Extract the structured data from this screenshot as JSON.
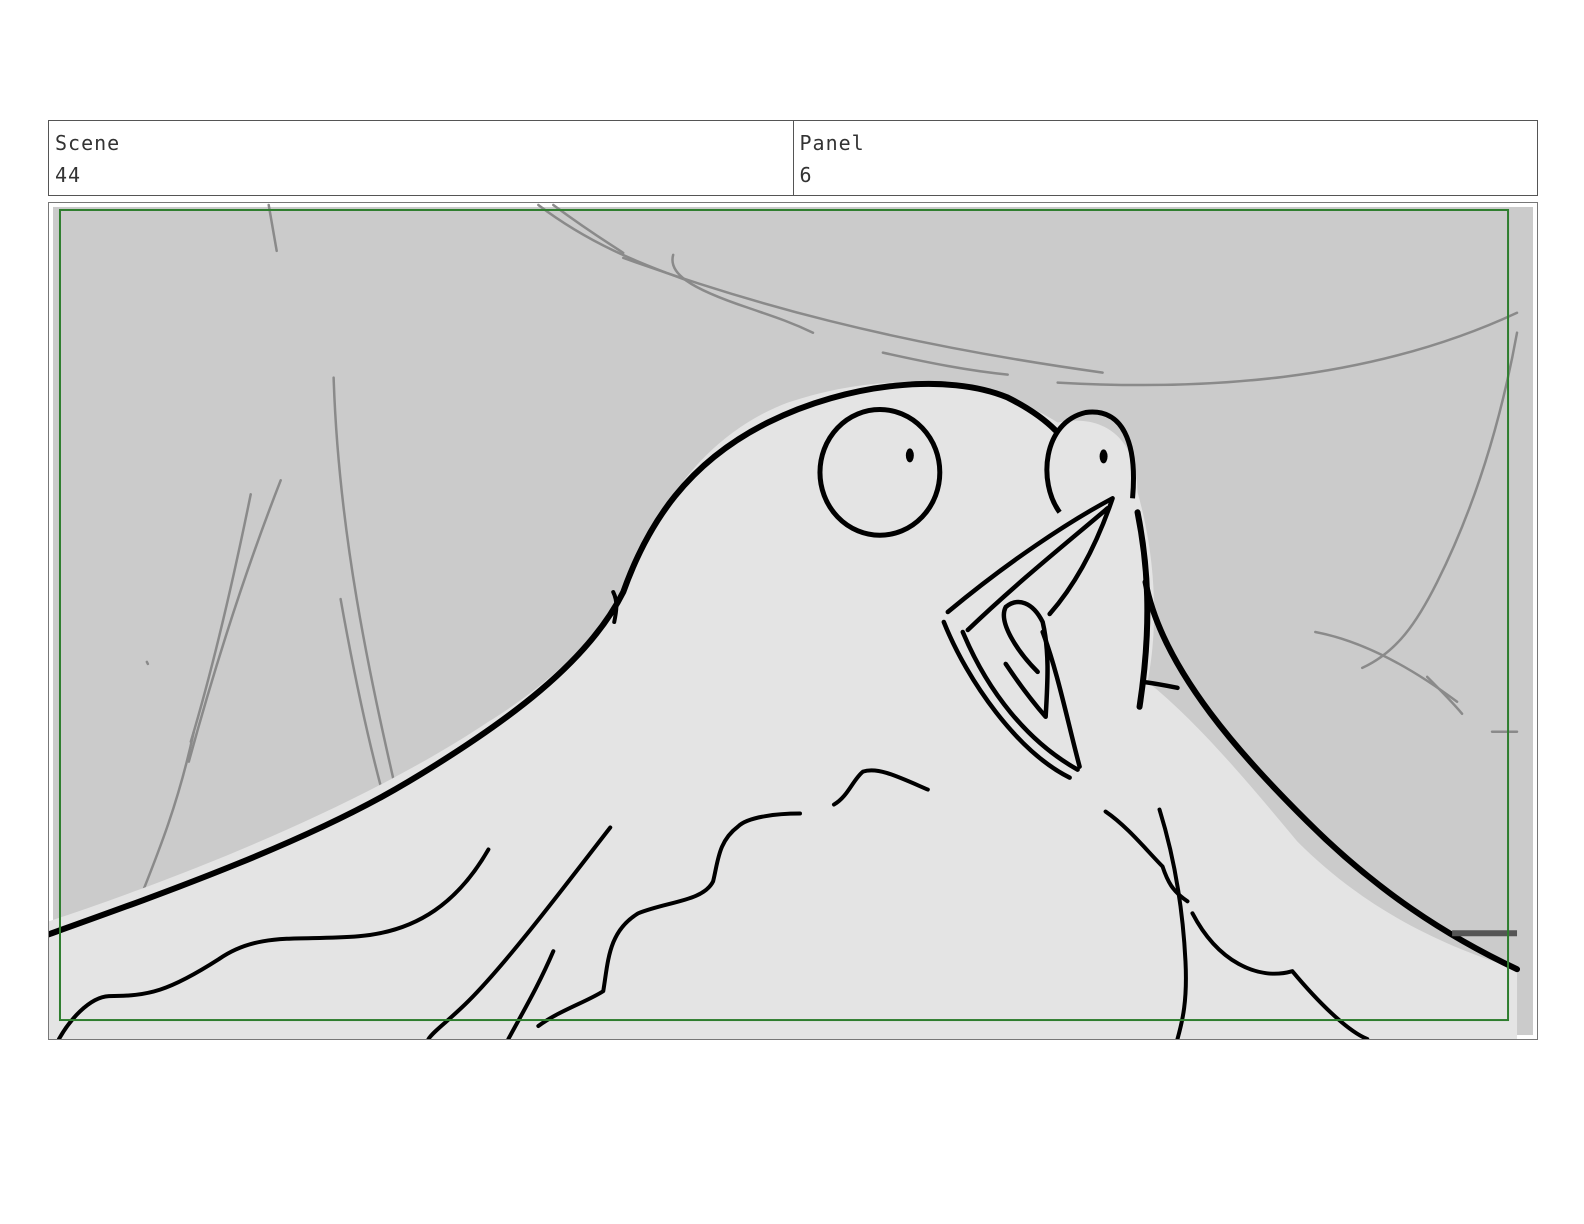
{
  "header": {
    "scene_label": "Scene",
    "scene_value": "44",
    "panel_label": "Panel",
    "panel_value": "6"
  },
  "panel": {
    "background_color": "#cbcbcb",
    "figure_color": "#e4e4e4",
    "safe_frame_color": "#2e7d2e",
    "sketch_line_color": "#888888",
    "ink_line_color": "#000000",
    "subject": "bird-character-sketch"
  }
}
